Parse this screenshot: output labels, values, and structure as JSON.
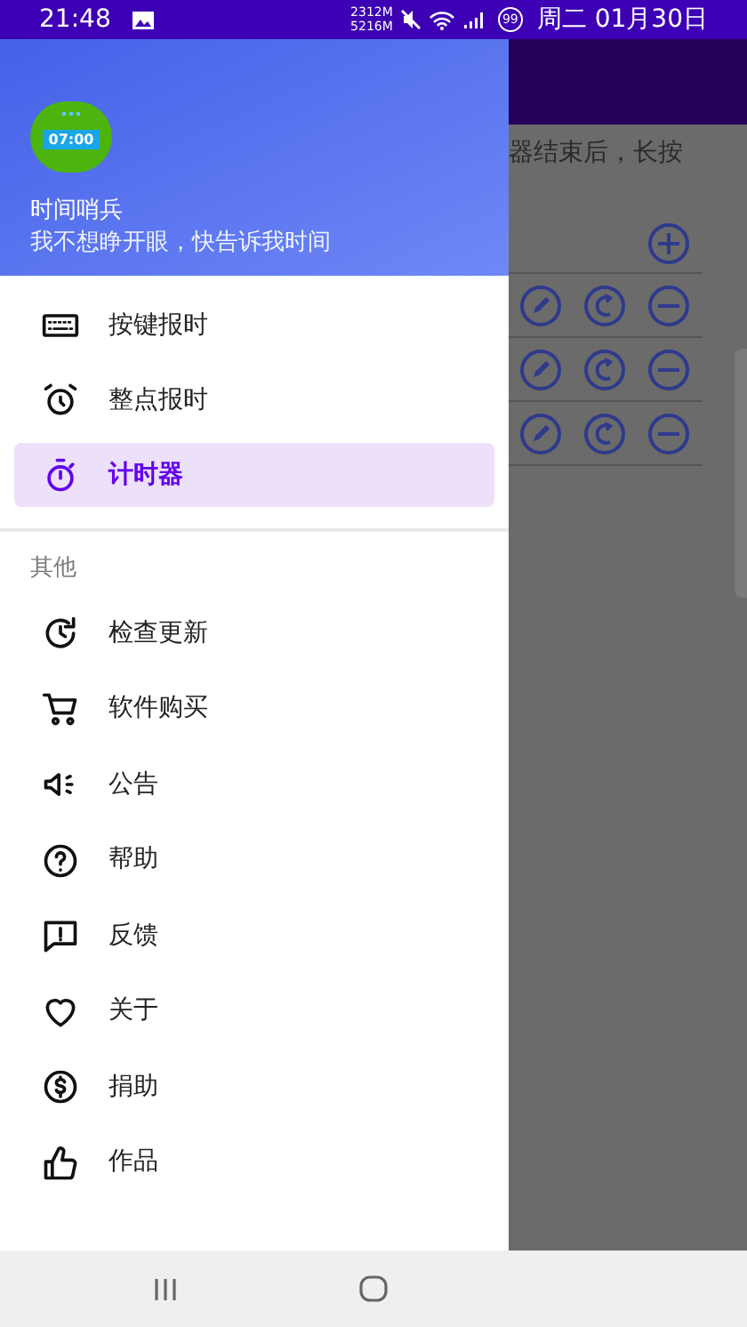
{
  "status_bar": {
    "time": "21:48",
    "memory_top": "2312M",
    "memory_bottom": "5216M",
    "badge": "99",
    "date": "周二 01月30日"
  },
  "drawer": {
    "header": {
      "title": "时间哨兵",
      "subtitle": "我不想睁开眼，快告诉我时间",
      "logo_time": "07:00"
    },
    "items": [
      {
        "label": "按键报时",
        "selected": false
      },
      {
        "label": "整点报时",
        "selected": false
      },
      {
        "label": "计时器",
        "selected": true
      }
    ],
    "section_title": "其他",
    "other_items": [
      {
        "label": "检查更新"
      },
      {
        "label": "软件购买"
      },
      {
        "label": "公告"
      },
      {
        "label": "帮助"
      },
      {
        "label": "反馈"
      },
      {
        "label": "关于"
      },
      {
        "label": "捐助"
      },
      {
        "label": "作品"
      }
    ]
  },
  "background": {
    "hint": "器结束后，长按"
  }
}
